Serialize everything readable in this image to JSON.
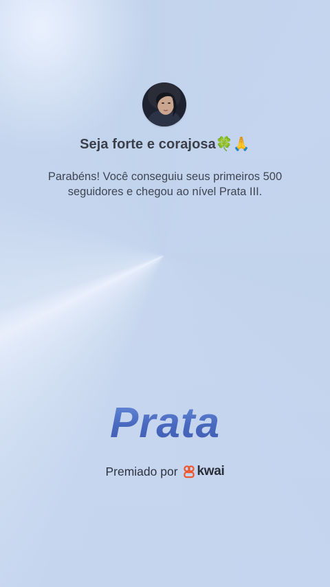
{
  "profile": {
    "title": "Seja forte e corajosa",
    "title_emoji": "🍀🙏"
  },
  "message": "Parabéns! Você conseguiu seus primeiros 500 seguidores e chegou ao nível Prata III.",
  "level": {
    "name": "Prata"
  },
  "award": {
    "label": "Premiado por",
    "brand": "kwai"
  },
  "colors": {
    "level_text": "#4d70c2",
    "brand_icon": "#f0532a",
    "background": "#c9d8ef"
  }
}
